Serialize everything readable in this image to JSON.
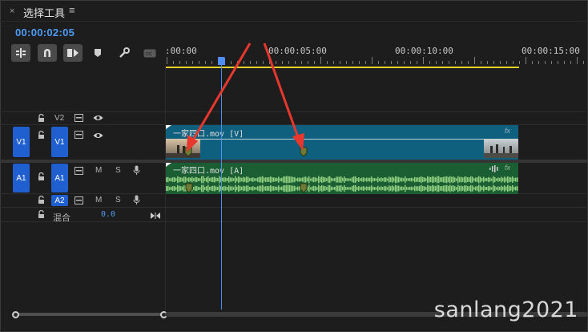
{
  "panel": {
    "close": "×",
    "title": "选择工具",
    "menu": "≡"
  },
  "timecode": "00:00:02:05",
  "toolbar": [
    {
      "name": "insert-snap-icon"
    },
    {
      "name": "snap-magnet-icon"
    },
    {
      "name": "linked-selection-icon"
    },
    {
      "name": "add-marker-icon"
    },
    {
      "name": "wrench-settings-icon"
    },
    {
      "name": "captions-icon"
    }
  ],
  "ruler": {
    "labels": [
      ":00:00",
      "00:00:05:00",
      "00:00:10:00",
      "00:00:15:00"
    ]
  },
  "tracks": {
    "v2": {
      "label": "V2"
    },
    "v1": {
      "source": "V1",
      "label": "V1"
    },
    "a1": {
      "source": "A1",
      "label": "A1",
      "m": "M",
      "s": "S"
    },
    "a2": {
      "label": "A2",
      "m": "M",
      "s": "S"
    },
    "mix": {
      "label": "混合",
      "value": "0.0"
    }
  },
  "clips": {
    "video": {
      "name": "一家四口.mov [V]",
      "fx": "fx"
    },
    "audio": {
      "name": "一家四口.mov [A]",
      "fx": "fx"
    }
  },
  "colors": {
    "accent": "#4e9cf5",
    "video_clip": "#0f5f7e",
    "audio_clip": "#1b5e33",
    "work_area": "#e7d02b",
    "annotation_arrow": "#e8372d"
  },
  "watermark": "sanlang2021"
}
